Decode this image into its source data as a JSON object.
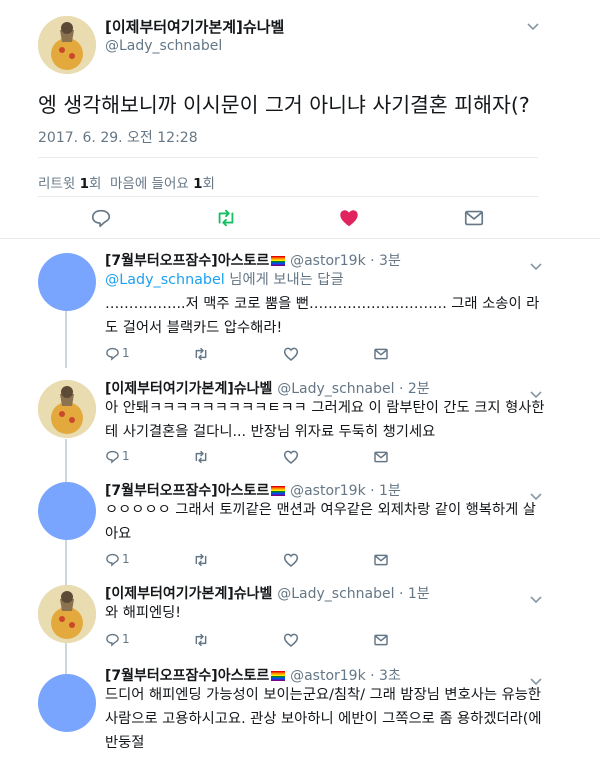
{
  "main_tweet": {
    "display_name": "[이제부터여기가본계]슈나벨",
    "handle": "@Lady_schnabel",
    "text": "엥 생각해보니까 이시문이 그거 아니냐 사기결혼 피해자(?",
    "timestamp": "2017. 6. 29. 오전 12:28",
    "retweets_label": "리트윗",
    "retweets_count": "1",
    "retweets_unit": "회",
    "likes_label": "마음에 들어요",
    "likes_count": "1",
    "likes_unit": "회",
    "liked": true
  },
  "colors": {
    "accent": "#1da1f2",
    "retweet_green": "#17bf63",
    "like_red": "#e0245e",
    "muted": "#657786"
  },
  "replies": [
    {
      "display_name": "[7월부터오프잠수]아스토르",
      "meta": "@astor19k · 3분",
      "flag": "rainbow-flag",
      "reply_to_handle": "@Lady_schnabel",
      "reply_to_suffix": " 님에게 보내는 답글",
      "text": "……………..저 맥주 코로 뿜을 뻔……………………….. 그래 소송이 라도 걸어서 블랙카드 압수해라!",
      "reply_count": "1",
      "avatar": "blue"
    },
    {
      "display_name": "[이제부터여기가본계]슈나벨",
      "meta": "@Lady_schnabel · 2분",
      "text": "아 안퇘ㅋㅋㅋㅋㅋㅋㅋㅋㅋㅌㅋㅋ 그러게요 이 람부탄이 간도 크지 형사한 테 사기결혼을 걸다니... 반장님 위자료 두둑히 챙기세요",
      "reply_count": "1",
      "avatar": "image"
    },
    {
      "display_name": "[7월부터오프잠수]아스토르",
      "meta": "@astor19k · 1분",
      "flag": "rainbow-flag",
      "text": "ㅇㅇㅇㅇㅇ 그래서 토끼같은 맨션과 여우같은 외제차랑 같이 행복하게 살아요",
      "reply_count": "1",
      "avatar": "blue"
    },
    {
      "display_name": "[이제부터여기가본계]슈나벨",
      "meta": "@Lady_schnabel · 1분",
      "text": "와 해피엔딩!",
      "reply_count": "1",
      "avatar": "image"
    },
    {
      "display_name": "[7월부터오프잠수]아스토르",
      "meta": "@astor19k · 3초",
      "flag": "rainbow-flag",
      "text": "드디어 해피엔딩 가능성이 보이는군요/침착/ 그래 밤장님 변호사는 유능한 사람으로 고용하시고요. 관상 보아하니 에반이 그쪽으로 좀 용하겠더라(에반둥절",
      "avatar": "blue"
    }
  ]
}
